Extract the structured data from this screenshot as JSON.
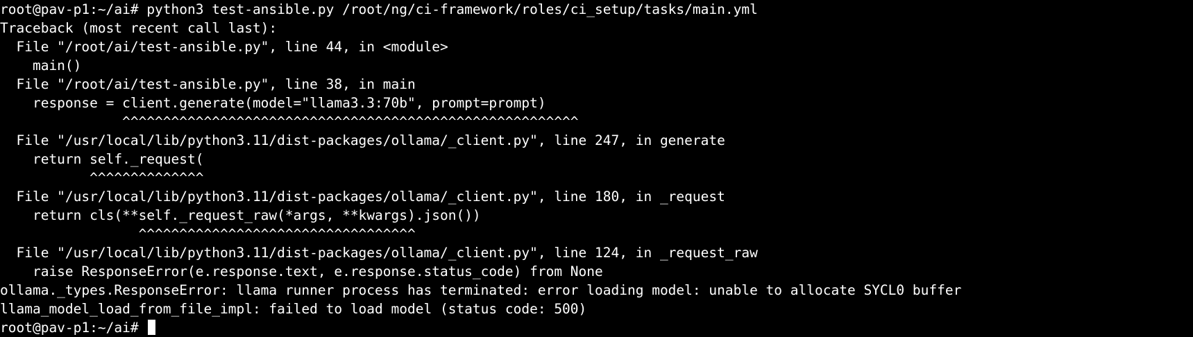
{
  "terminal": {
    "lines": [
      "root@pav-p1:~/ai# python3 test-ansible.py /root/ng/ci-framework/roles/ci_setup/tasks/main.yml",
      "Traceback (most recent call last):",
      "  File \"/root/ai/test-ansible.py\", line 44, in <module>",
      "    main()",
      "  File \"/root/ai/test-ansible.py\", line 38, in main",
      "    response = client.generate(model=\"llama3.3:70b\", prompt=prompt)",
      "               ^^^^^^^^^^^^^^^^^^^^^^^^^^^^^^^^^^^^^^^^^^^^^^^^^^^^^^^^",
      "  File \"/usr/local/lib/python3.11/dist-packages/ollama/_client.py\", line 247, in generate",
      "    return self._request(",
      "           ^^^^^^^^^^^^^^",
      "  File \"/usr/local/lib/python3.11/dist-packages/ollama/_client.py\", line 180, in _request",
      "    return cls(**self._request_raw(*args, **kwargs).json())",
      "                 ^^^^^^^^^^^^^^^^^^^^^^^^^^^^^^^^^^",
      "  File \"/usr/local/lib/python3.11/dist-packages/ollama/_client.py\", line 124, in _request_raw",
      "    raise ResponseError(e.response.text, e.response.status_code) from None",
      "ollama._types.ResponseError: llama runner process has terminated: error loading model: unable to allocate SYCL0 buffer",
      "llama_model_load_from_file_impl: failed to load model (status code: 500)"
    ],
    "prompt": "root@pav-p1:~/ai# "
  },
  "colors": {
    "background": "#000000",
    "foreground": "#ffffff"
  }
}
